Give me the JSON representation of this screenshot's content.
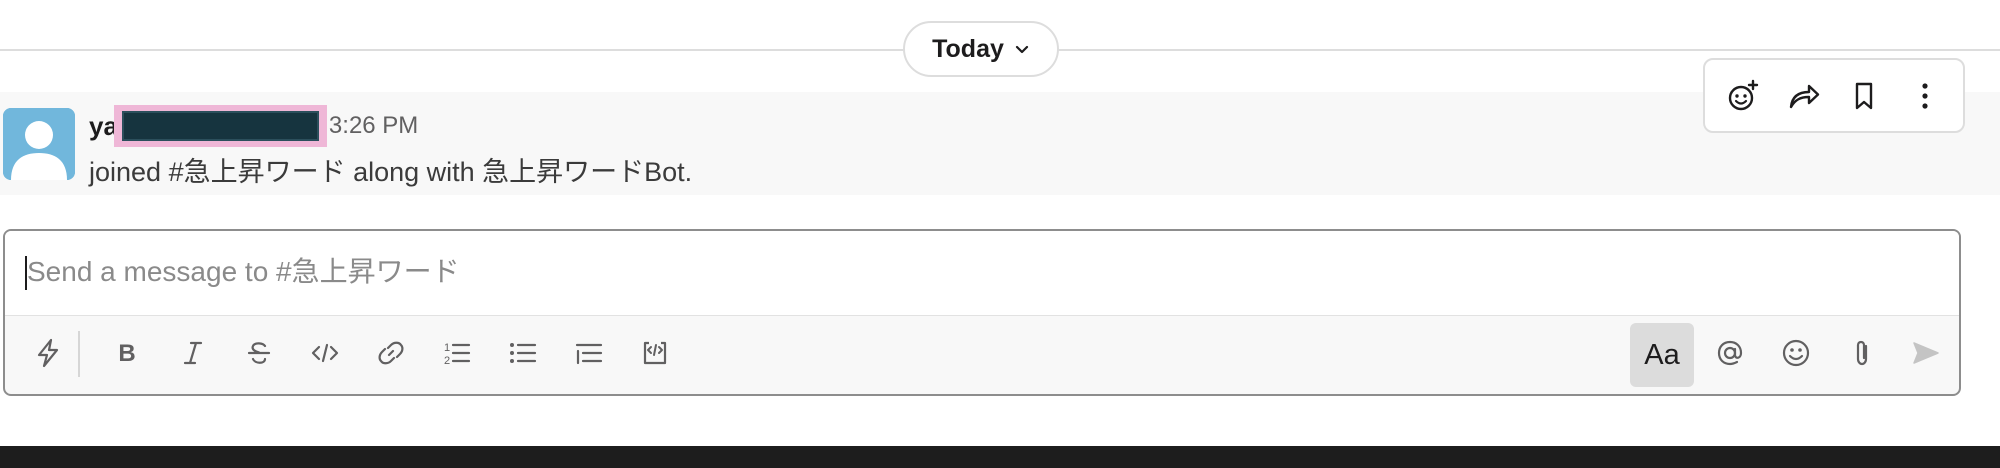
{
  "day_divider": {
    "label": "Today"
  },
  "message": {
    "username_visible": "ya",
    "time": "3:26 PM",
    "text": "joined #急上昇ワード along with 急上昇ワードBot."
  },
  "hover_actions": {
    "items": [
      "add-reaction-icon",
      "share-forward-icon",
      "bookmark-icon",
      "more-vertical-icon"
    ]
  },
  "composer": {
    "placeholder": "Send a message to #急上昇ワード",
    "value": "",
    "format_toggle_label": "Aa",
    "toolbar_icons": [
      "shortcuts-lightning-icon",
      "bold-icon",
      "italic-icon",
      "strikethrough-icon",
      "code-icon",
      "link-icon",
      "ordered-list-icon",
      "bulleted-list-icon",
      "blockquote-icon",
      "code-block-icon"
    ],
    "right_icons": [
      "mention-icon",
      "emoji-icon",
      "attach-icon",
      "send-icon"
    ]
  },
  "colors": {
    "avatar_bg": "#71b7dc",
    "redaction_highlight": "#efb7d7",
    "redaction_fill": "#16343f"
  }
}
